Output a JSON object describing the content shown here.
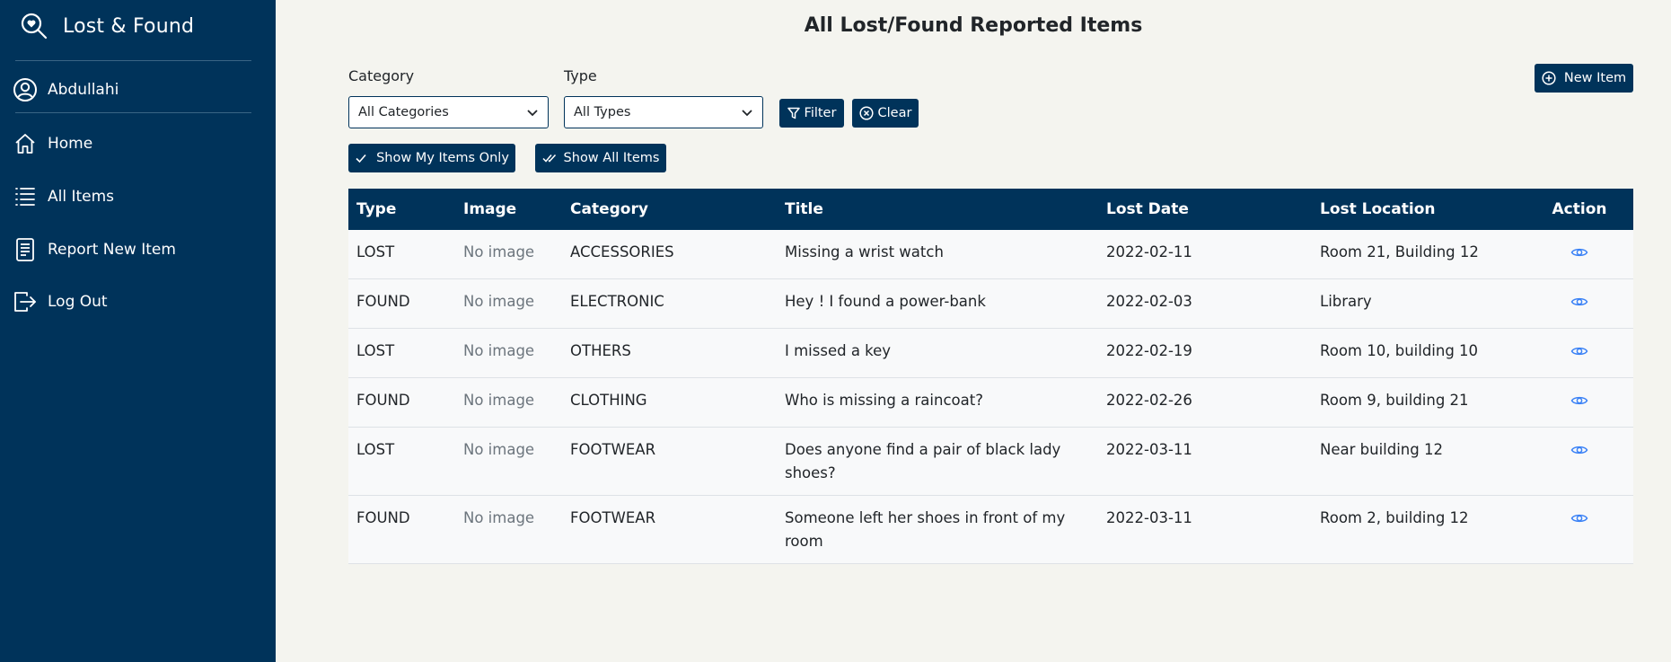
{
  "app": {
    "title": "Lost & Found"
  },
  "sidebar": {
    "user": "Abdullahi",
    "items": [
      {
        "label": "Home",
        "icon": "home-icon"
      },
      {
        "label": "All Items",
        "icon": "list-icon"
      },
      {
        "label": "Report New Item",
        "icon": "document-icon"
      },
      {
        "label": "Log Out",
        "icon": "logout-icon"
      }
    ]
  },
  "main": {
    "title": "All Lost/Found Reported Items",
    "filters": {
      "category_label": "Category",
      "category_value": "All Categories",
      "type_label": "Type",
      "type_value": "All Types",
      "filter_button": "Filter",
      "clear_button": "Clear",
      "new_item_button": "New Item",
      "show_my_items": "Show My Items Only",
      "show_all_items": "Show All Items"
    },
    "table": {
      "headers": [
        "Type",
        "Image",
        "Category",
        "Title",
        "Lost Date",
        "Lost Location",
        "Action"
      ],
      "rows": [
        {
          "type": "LOST",
          "image": "No image",
          "category": "ACCESSORIES",
          "title": "Missing a wrist watch",
          "date": "2022-02-11",
          "location": "Room 21, Building 12"
        },
        {
          "type": "FOUND",
          "image": "No image",
          "category": "ELECTRONIC",
          "title": "Hey ! I found a power-bank",
          "date": "2022-02-03",
          "location": "Library"
        },
        {
          "type": "LOST",
          "image": "No image",
          "category": "OTHERS",
          "title": "I missed a key",
          "date": "2022-02-19",
          "location": "Room 10, building 10"
        },
        {
          "type": "FOUND",
          "image": "No image",
          "category": "CLOTHING",
          "title": "Who is missing a raincoat?",
          "date": "2022-02-26",
          "location": "Room 9, building 21"
        },
        {
          "type": "LOST",
          "image": "No image",
          "category": "FOOTWEAR",
          "title": "Does anyone find a pair of black lady shoes?",
          "date": "2022-03-11",
          "location": "Near building 12"
        },
        {
          "type": "FOUND",
          "image": "No image",
          "category": "FOOTWEAR",
          "title": "Someone left her shoes in front of my room",
          "date": "2022-03-11",
          "location": "Room 2, building 12"
        }
      ]
    }
  },
  "colors": {
    "primary": "#00335a",
    "background": "#f4f4ef",
    "action_icon": "#3b82f6"
  }
}
